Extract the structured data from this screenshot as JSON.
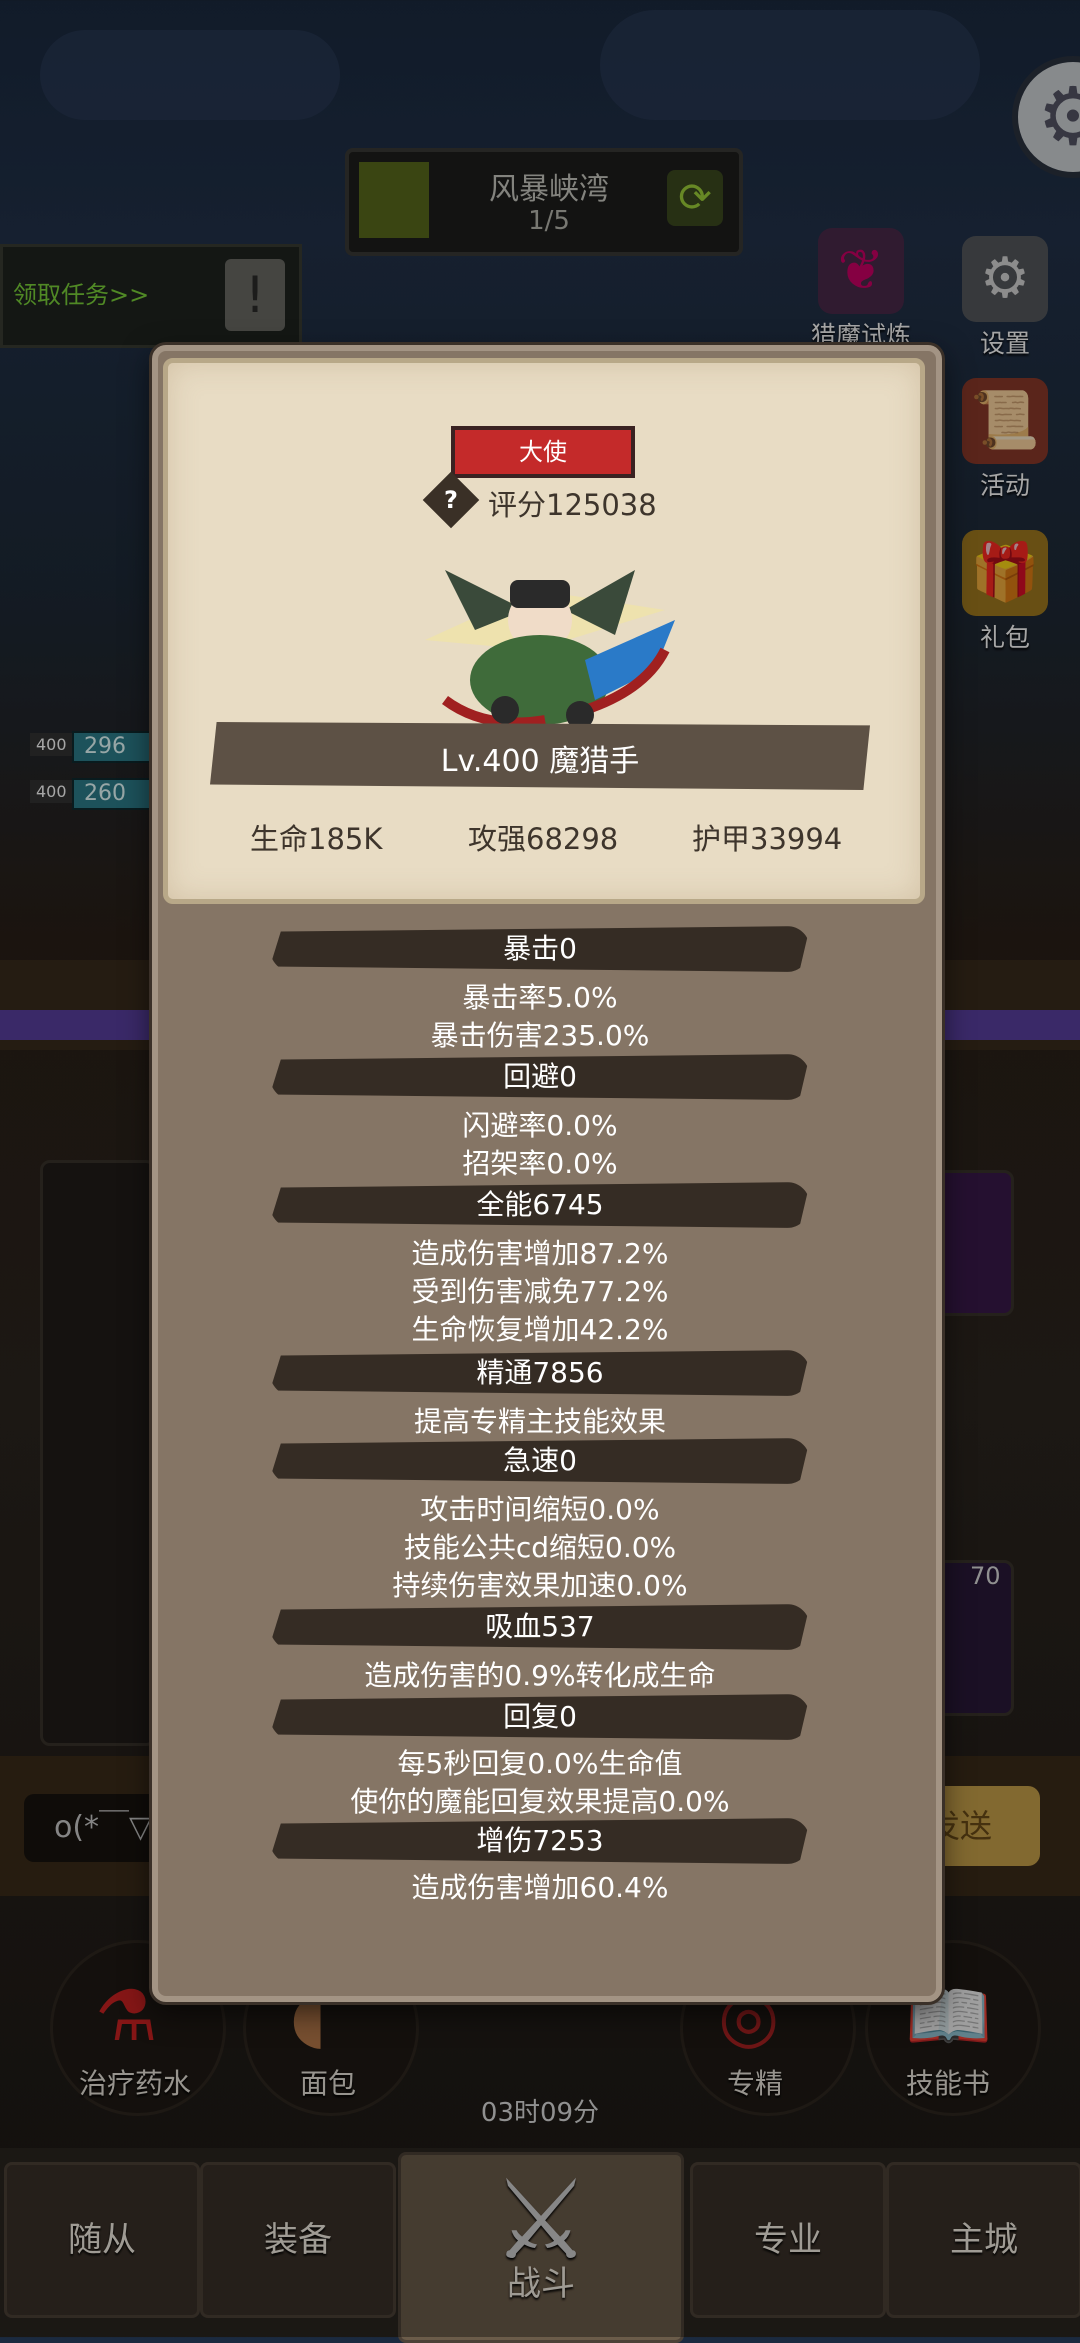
{
  "stage": {
    "name": "风暴峡湾",
    "progress": "1/5"
  },
  "quest": {
    "label": "领取任务>>"
  },
  "side_menu": [
    {
      "label": "猎魔试炼",
      "icon": "demon-wing-icon"
    },
    {
      "label": "设置",
      "icon": "gear-icon"
    },
    {
      "label": "活动",
      "icon": "scroll-icon"
    },
    {
      "label": "礼包",
      "icon": "gift-bag-icon"
    }
  ],
  "party": [
    {
      "level": "400",
      "hp": "296"
    },
    {
      "level": "400",
      "hp": "260"
    }
  ],
  "chat": {
    "input_text": "o(*￣▽",
    "send_label": "发送"
  },
  "items": [
    {
      "label": "治疗药水",
      "icon": "potion-icon"
    },
    {
      "label": "面包",
      "icon": "bread-icon"
    },
    {
      "label": "专精",
      "icon": "specialization-icon"
    },
    {
      "label": "技能书",
      "icon": "skill-book-icon"
    }
  ],
  "timer": "03时09分",
  "item_badge": "70",
  "nav": [
    {
      "label": "随从"
    },
    {
      "label": "装备"
    },
    {
      "label": "战斗"
    },
    {
      "label": "专业"
    },
    {
      "label": "主城"
    }
  ],
  "hero": {
    "rank": "大使",
    "score": "评分125038",
    "name": "Lv.400 魔猎手",
    "hp": "生命185K",
    "attack": "攻强68298",
    "armor": "护甲33994"
  },
  "stats": [
    {
      "title": "暴击0",
      "lines": [
        "暴击率5.0%",
        "暴击伤害235.0%"
      ]
    },
    {
      "title": "回避0",
      "lines": [
        "闪避率0.0%",
        "招架率0.0%"
      ]
    },
    {
      "title": "全能6745",
      "lines": [
        "造成伤害增加87.2%",
        "受到伤害减免77.2%",
        "生命恢复增加42.2%"
      ]
    },
    {
      "title": "精通7856",
      "lines": [
        "提高专精主技能效果"
      ]
    },
    {
      "title": "急速0",
      "lines": [
        "攻击时间缩短0.0%",
        "技能公共cd缩短0.0%",
        "持续伤害效果加速0.0%"
      ]
    },
    {
      "title": "吸血537",
      "lines": [
        "造成伤害的0.9%转化成生命"
      ]
    },
    {
      "title": "回复0",
      "lines": [
        "每5秒回复0.0%生命值",
        "使你的魔能回复效果提高0.0%"
      ]
    },
    {
      "title": "增伤7253",
      "lines": [
        "造成伤害增加60.4%"
      ]
    }
  ]
}
